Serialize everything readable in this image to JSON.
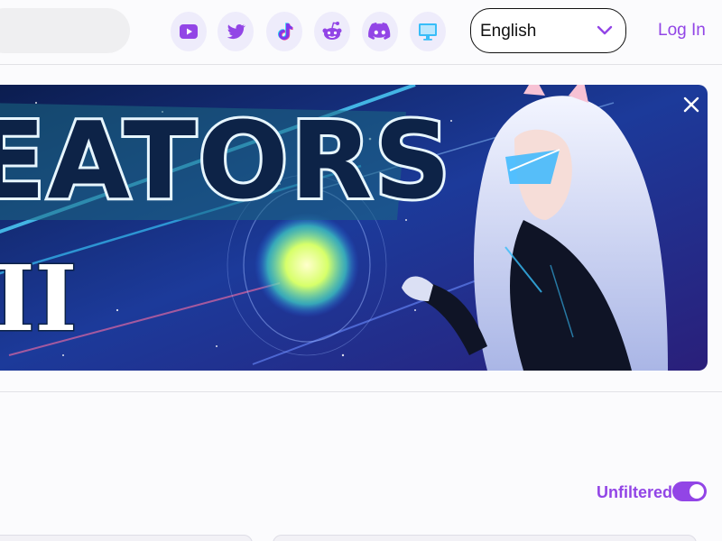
{
  "header": {
    "language_selected": "English",
    "login_label": "Log In",
    "social_icons": [
      "youtube-icon",
      "twitter-icon",
      "tiktok-icon",
      "reddit-icon",
      "discord-icon",
      "desktop-icon"
    ]
  },
  "banner": {
    "heading_text": "EATORS",
    "subheading_text": "II"
  },
  "filter": {
    "label": "Unfiltered",
    "enabled": true
  },
  "colors": {
    "accent": "#9245e6",
    "icon_bg": "#eeecfb",
    "page_bg": "#fbfbfd"
  }
}
